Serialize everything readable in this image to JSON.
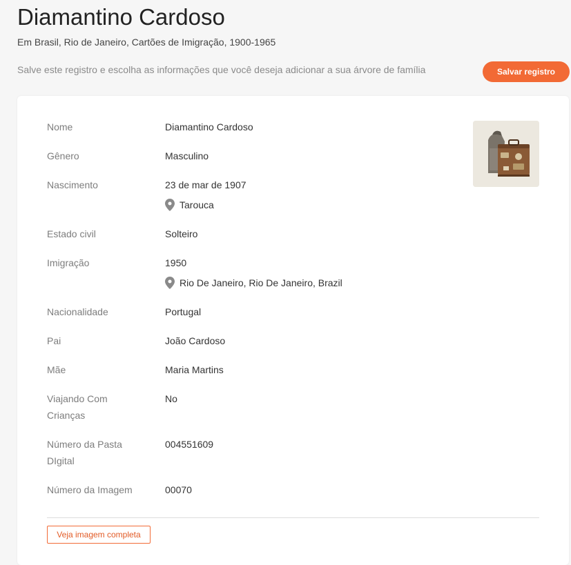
{
  "header": {
    "title": "Diamantino Cardoso",
    "subtitle": "Em Brasil, Rio de Janeiro, Cartões de Imigração, 1900-1965",
    "save_message": "Salve este registro e escolha as informações que você deseja adicionar a sua árvore de família",
    "save_button": "Salvar registro"
  },
  "record": {
    "nome": {
      "label": "Nome",
      "value": "Diamantino Cardoso"
    },
    "genero": {
      "label": "Gênero",
      "value": "Masculino"
    },
    "nascimento": {
      "label": "Nascimento",
      "value": "23 de mar de 1907",
      "place": "Tarouca"
    },
    "estado_civil": {
      "label": "Estado civil",
      "value": "Solteiro"
    },
    "imigracao": {
      "label": "Imigração",
      "value": "1950",
      "place": "Rio De Janeiro, Rio De Janeiro, Brazil"
    },
    "nacionalidade": {
      "label": "Nacionalidade",
      "value": "Portugal"
    },
    "pai": {
      "label": "Pai",
      "value": "João Cardoso"
    },
    "mae": {
      "label": "Mãe",
      "value": "Maria Martins"
    },
    "viajando": {
      "label_line1": "Viajando Com",
      "label_line2": "Crianças",
      "value": "No"
    },
    "pasta": {
      "label_line1": "Número da Pasta",
      "label_line2": "DIgital",
      "value": "004551609"
    },
    "imagem": {
      "label": "Número da Imagem",
      "value": "00070"
    }
  },
  "footer": {
    "view_image_button": "Veja imagem completa"
  },
  "icons": {
    "place": "map-pin-icon",
    "thumbnail": "suitcase-icon"
  },
  "colors": {
    "accent": "#f26a35",
    "background": "#f6f6f6",
    "label": "#7d7d7d",
    "value": "#333333"
  }
}
